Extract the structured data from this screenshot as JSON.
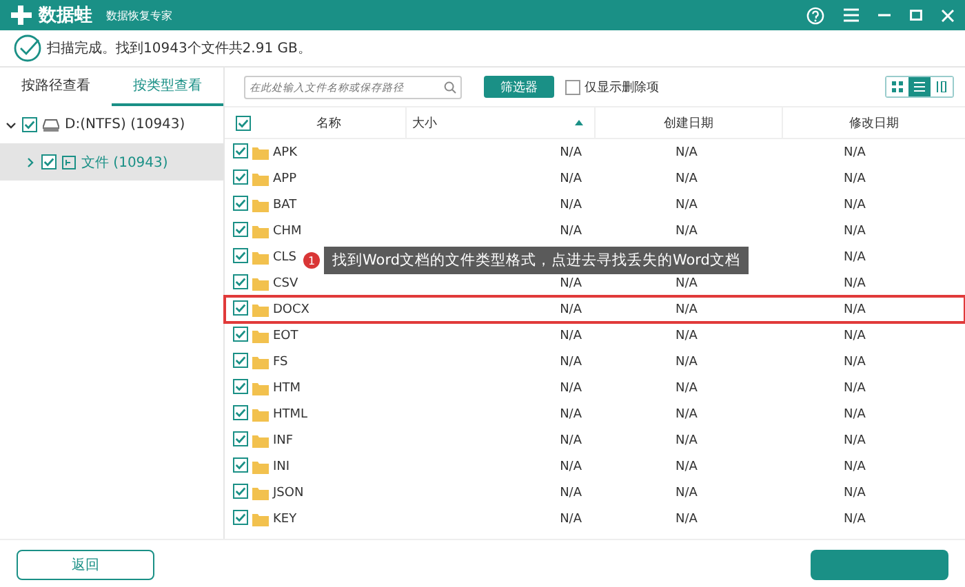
{
  "header": {
    "logo": "数据蛙",
    "subtitle": "数据恢复专家"
  },
  "status": {
    "message": "扫描完成。找到10943个文件共2.91 GB。"
  },
  "left_tabs": [
    {
      "label": "按路径查看",
      "selected": false
    },
    {
      "label": "按类型查看",
      "selected": true
    }
  ],
  "tree": [
    {
      "label": "D:(NTFS) (10943)",
      "checked": true,
      "expanded": true,
      "selected": false,
      "children": [
        {
          "label": "文件 (10943)",
          "checked": true,
          "expanded": false,
          "selected": true
        }
      ]
    }
  ],
  "toolbar": {
    "search_placeholder": "在此处输入文件名称或保存路径",
    "filter_button": "筛选器",
    "deleted_only": {
      "label": "仅显示删除项",
      "checked": false
    },
    "views": [
      {
        "selected": false
      },
      {
        "selected": true
      },
      {
        "selected": false
      }
    ]
  },
  "table": {
    "all_checked": true,
    "columns": [
      "名称",
      "大小",
      "创建日期",
      "修改日期"
    ],
    "rows": [
      {
        "name": "APK",
        "checked": true,
        "size": "N/A",
        "created": "N/A",
        "modified": "N/A",
        "highlighted": false
      },
      {
        "name": "APP",
        "checked": true,
        "size": "N/A",
        "created": "N/A",
        "modified": "N/A",
        "highlighted": false
      },
      {
        "name": "BAT",
        "checked": true,
        "size": "N/A",
        "created": "N/A",
        "modified": "N/A",
        "highlighted": false
      },
      {
        "name": "CHM",
        "checked": true,
        "size": "N/A",
        "created": "N/A",
        "modified": "N/A",
        "highlighted": false
      },
      {
        "name": "CLS",
        "checked": true,
        "modified": "N/A",
        "highlighted": false
      },
      {
        "name": "CSV",
        "checked": true,
        "size": "N/A",
        "created": "N/A",
        "modified": "N/A",
        "highlighted": false
      },
      {
        "name": "DOCX",
        "checked": true,
        "size": "N/A",
        "created": "N/A",
        "modified": "N/A",
        "highlighted": true
      },
      {
        "name": "EOT",
        "checked": true,
        "size": "N/A",
        "created": "N/A",
        "modified": "N/A",
        "highlighted": false
      },
      {
        "name": "FS",
        "checked": true,
        "size": "N/A",
        "created": "N/A",
        "modified": "N/A",
        "highlighted": false
      },
      {
        "name": "HTM",
        "checked": true,
        "size": "N/A",
        "created": "N/A",
        "modified": "N/A",
        "highlighted": false
      },
      {
        "name": "HTML",
        "checked": true,
        "size": "N/A",
        "created": "N/A",
        "modified": "N/A",
        "highlighted": false
      },
      {
        "name": "INF",
        "checked": true,
        "size": "N/A",
        "created": "N/A",
        "modified": "N/A",
        "highlighted": false
      },
      {
        "name": "INI",
        "checked": true,
        "size": "N/A",
        "created": "N/A",
        "modified": "N/A",
        "highlighted": false
      },
      {
        "name": "JSON",
        "checked": true,
        "size": "N/A",
        "created": "N/A",
        "modified": "N/A",
        "highlighted": false
      },
      {
        "name": "KEY",
        "checked": true,
        "size": "N/A",
        "created": "N/A",
        "modified": "N/A",
        "highlighted": false
      }
    ]
  },
  "tooltip": {
    "badge": "1",
    "text": "找到Word文档的文件类型格式，点进去寻找丢失的Word文档"
  },
  "footer": {
    "back_button": "返回"
  }
}
